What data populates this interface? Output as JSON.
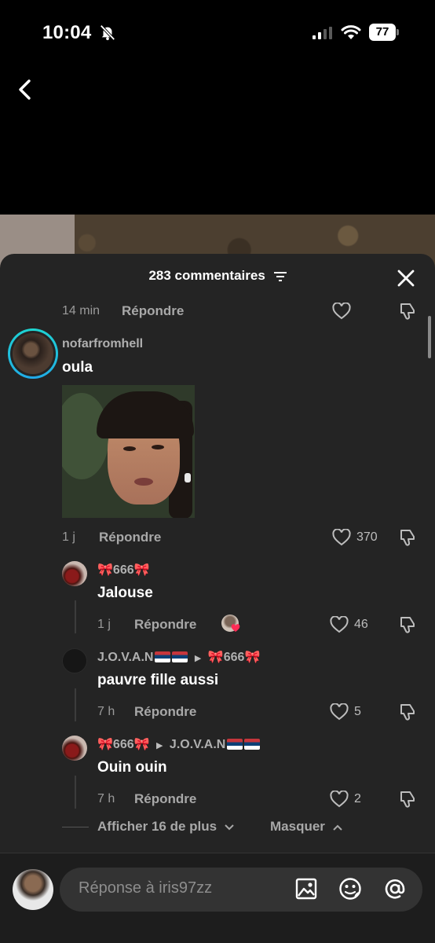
{
  "status_bar": {
    "time": "10:04",
    "battery": "77"
  },
  "header": {
    "title": "283 commentaires"
  },
  "top_row": {
    "time": "14 min",
    "reply_label": "Répondre"
  },
  "main_comment": {
    "username": "nofarfromhell",
    "text": "oula",
    "time": "1 j",
    "reply_label": "Répondre",
    "likes": "370"
  },
  "replies": [
    {
      "username": "666",
      "text": "Jalouse",
      "time": "1 j",
      "reply_label": "Répondre",
      "likes": "46"
    },
    {
      "username": "J.O.V.A.N",
      "replying_to": "666",
      "text": "pauvre fille aussi",
      "time": "7 h",
      "reply_label": "Répondre",
      "likes": "5"
    },
    {
      "username": "666",
      "replying_to": "J.O.V.A.N",
      "text": "Ouin ouin",
      "time": "7 h",
      "reply_label": "Répondre",
      "likes": "2"
    }
  ],
  "thread_controls": {
    "show_more": "Afficher 16 de plus",
    "hide": "Masquer"
  },
  "input": {
    "placeholder": "Réponse à iris97zz"
  },
  "icons": [
    "bell-off-icon",
    "signal-icon",
    "wifi-icon",
    "battery-icon",
    "back-icon",
    "filter-icon",
    "close-icon",
    "heart-icon",
    "dislike-icon",
    "image-icon",
    "sticker-icon",
    "mention-icon"
  ],
  "colors": {
    "sheet": "#242424",
    "ring": "#1ed7d0",
    "bow": "#f08aa8",
    "liked_heart": "#fe2c55"
  }
}
